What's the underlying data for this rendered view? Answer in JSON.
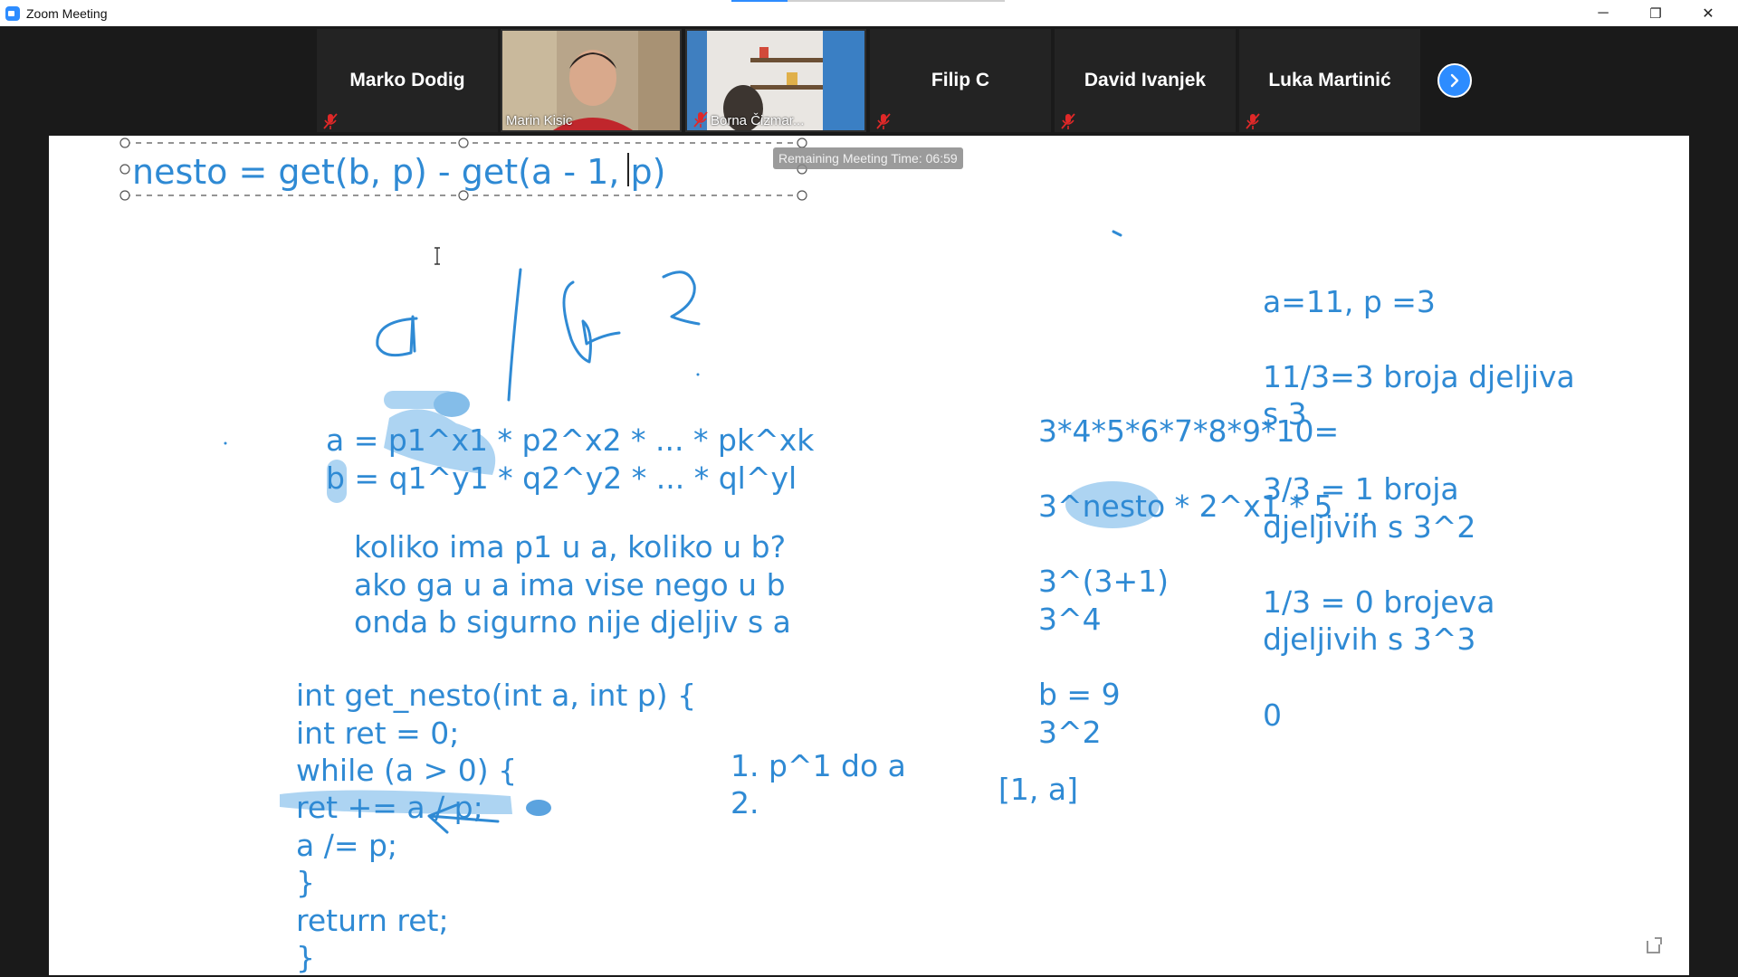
{
  "window": {
    "title": "Zoom Meeting",
    "controls": {
      "minimize": "─",
      "restore": "❐",
      "close": "✕"
    }
  },
  "participants": [
    {
      "name": "Marko Dodig",
      "muted": true,
      "video": false
    },
    {
      "name": "Marin Kisic",
      "muted": false,
      "video": true
    },
    {
      "name": "Borna Čizmar...",
      "muted": true,
      "video": true
    },
    {
      "name": "Filip C",
      "muted": true,
      "video": false
    },
    {
      "name": "David Ivanjek",
      "muted": true,
      "video": false
    },
    {
      "name": "Luka Martinić",
      "muted": true,
      "video": false
    }
  ],
  "whiteboard": {
    "timer": "Remaining Meeting Time: 06:59",
    "selected_text": "nesto = get(b, p) - get(a - 1, p)",
    "formula_a": "a = p1^x1 * p2^x2 * ... * pk^xk",
    "formula_b": "b = q1^y1 * q2^y2 * ... * ql^yl",
    "question_lines": [
      "koliko ima p1 u a, koliko u b?",
      "ako ga u a ima vise nego u b",
      "onda b sigurno nije djeljiv s a"
    ],
    "code_lines": [
      "int get_nesto(int a, int p) {",
      "int ret = 0;",
      "while (a > 0) {",
      "ret += a / p;",
      "a /= p;",
      "}",
      "return ret;",
      "}"
    ],
    "steps": [
      "1. p^1 do a",
      "2."
    ],
    "middle_lines": [
      "3*4*5*6*7*8*9*10=",
      "3^nesto * 2^x1 * 5 ...",
      "3^(3+1)",
      "3^4",
      "b = 9",
      "3^2",
      "[1, a]"
    ],
    "right_lines": [
      "a=11, p =3",
      "11/3=3 broja djeljiva",
      "s 3",
      "3/3 = 1 broja",
      "djeljivih s 3^2",
      "1/3 = 0 brojeva",
      "djeljivih s 3^3",
      "0"
    ]
  },
  "colors": {
    "ink": "#2f8ad4",
    "highlight": "#9fcdf0",
    "accent": "#2d8cff",
    "muted_mic": "#e02828"
  }
}
